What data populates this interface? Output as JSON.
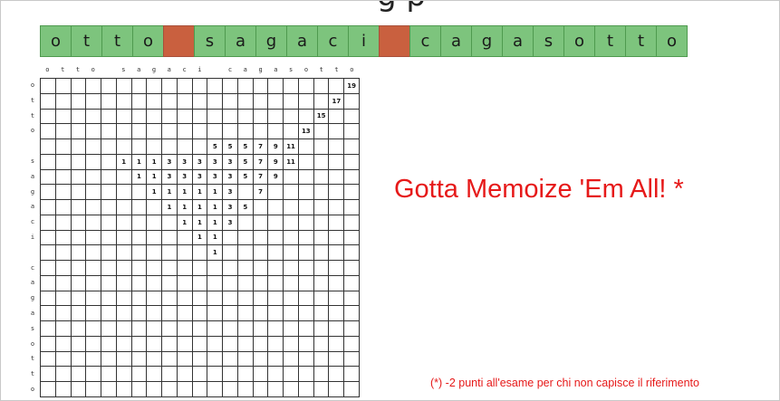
{
  "slide": {
    "title_fragment": "g p",
    "headline": "Gotta Memoize 'Em All! *",
    "footnote": "(*) -2 punti all'esame per chi non capisce il riferimento"
  },
  "strip": {
    "cells": [
      "o",
      "t",
      "t",
      "o",
      "",
      "s",
      "a",
      "g",
      "a",
      "c",
      "i",
      "",
      "c",
      "a",
      "g",
      "a",
      "s",
      "o",
      "t",
      "t",
      "o"
    ],
    "colors": {
      "letter": "#7dc47d",
      "gap": "#c9603f"
    }
  },
  "table": {
    "col_headers": [
      "o",
      "t",
      "t",
      "o",
      "",
      "s",
      "a",
      "g",
      "a",
      "c",
      "i",
      "",
      "c",
      "a",
      "g",
      "a",
      "s",
      "o",
      "t",
      "t",
      "o"
    ],
    "row_headers": [
      "o",
      "t",
      "t",
      "o",
      "",
      "s",
      "a",
      "g",
      "a",
      "c",
      "i",
      "",
      "c",
      "a",
      "g",
      "a",
      "s",
      "o",
      "t",
      "t",
      "o"
    ],
    "cells": [
      {
        "r": 0,
        "c": 20,
        "v": "19"
      },
      {
        "r": 1,
        "c": 19,
        "v": "17"
      },
      {
        "r": 2,
        "c": 18,
        "v": "15"
      },
      {
        "r": 3,
        "c": 17,
        "v": "13"
      },
      {
        "r": 4,
        "c": 11,
        "v": "5"
      },
      {
        "r": 4,
        "c": 12,
        "v": "5"
      },
      {
        "r": 4,
        "c": 13,
        "v": "5"
      },
      {
        "r": 4,
        "c": 14,
        "v": "7"
      },
      {
        "r": 4,
        "c": 15,
        "v": "9"
      },
      {
        "r": 4,
        "c": 16,
        "v": "11"
      },
      {
        "r": 5,
        "c": 5,
        "v": "1"
      },
      {
        "r": 5,
        "c": 6,
        "v": "1"
      },
      {
        "r": 5,
        "c": 7,
        "v": "1"
      },
      {
        "r": 5,
        "c": 8,
        "v": "3"
      },
      {
        "r": 5,
        "c": 9,
        "v": "3"
      },
      {
        "r": 5,
        "c": 10,
        "v": "3"
      },
      {
        "r": 5,
        "c": 11,
        "v": "3"
      },
      {
        "r": 5,
        "c": 12,
        "v": "3"
      },
      {
        "r": 5,
        "c": 13,
        "v": "5"
      },
      {
        "r": 5,
        "c": 14,
        "v": "7"
      },
      {
        "r": 5,
        "c": 15,
        "v": "9"
      },
      {
        "r": 5,
        "c": 16,
        "v": "11"
      },
      {
        "r": 6,
        "c": 6,
        "v": "1"
      },
      {
        "r": 6,
        "c": 7,
        "v": "1"
      },
      {
        "r": 6,
        "c": 8,
        "v": "3"
      },
      {
        "r": 6,
        "c": 9,
        "v": "3"
      },
      {
        "r": 6,
        "c": 10,
        "v": "3"
      },
      {
        "r": 6,
        "c": 11,
        "v": "3"
      },
      {
        "r": 6,
        "c": 12,
        "v": "3"
      },
      {
        "r": 6,
        "c": 13,
        "v": "5"
      },
      {
        "r": 6,
        "c": 14,
        "v": "7"
      },
      {
        "r": 6,
        "c": 15,
        "v": "9"
      },
      {
        "r": 7,
        "c": 7,
        "v": "1"
      },
      {
        "r": 7,
        "c": 8,
        "v": "1"
      },
      {
        "r": 7,
        "c": 9,
        "v": "1"
      },
      {
        "r": 7,
        "c": 10,
        "v": "1"
      },
      {
        "r": 7,
        "c": 11,
        "v": "1"
      },
      {
        "r": 7,
        "c": 12,
        "v": "3"
      },
      {
        "r": 7,
        "c": 14,
        "v": "7"
      },
      {
        "r": 8,
        "c": 8,
        "v": "1"
      },
      {
        "r": 8,
        "c": 9,
        "v": "1"
      },
      {
        "r": 8,
        "c": 10,
        "v": "1"
      },
      {
        "r": 8,
        "c": 11,
        "v": "1"
      },
      {
        "r": 8,
        "c": 12,
        "v": "3"
      },
      {
        "r": 8,
        "c": 13,
        "v": "5"
      },
      {
        "r": 9,
        "c": 9,
        "v": "1"
      },
      {
        "r": 9,
        "c": 10,
        "v": "1"
      },
      {
        "r": 9,
        "c": 11,
        "v": "1"
      },
      {
        "r": 9,
        "c": 12,
        "v": "3"
      },
      {
        "r": 10,
        "c": 10,
        "v": "1"
      },
      {
        "r": 10,
        "c": 11,
        "v": "1"
      },
      {
        "r": 11,
        "c": 11,
        "v": "1"
      }
    ]
  }
}
